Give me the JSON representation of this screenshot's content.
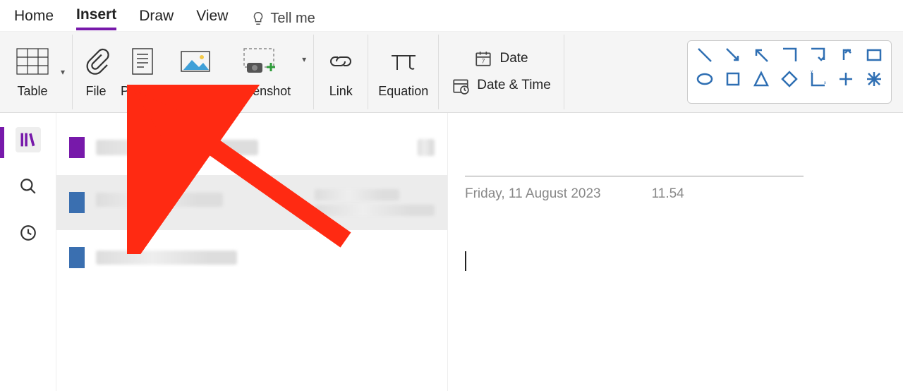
{
  "tabs": {
    "home": "Home",
    "insert": "Insert",
    "draw": "Draw",
    "view": "View",
    "tellme": "Tell me"
  },
  "ribbon": {
    "table": "Table",
    "file": "File",
    "printout": "Printout",
    "picture": "Picture",
    "screenshot": "Screenshot",
    "link": "Link",
    "equation": "Equation",
    "date": "Date",
    "datetime": "Date & Time"
  },
  "page": {
    "date": "Friday, 11 August 2023",
    "time": "11.54"
  },
  "colors": {
    "accent": "#7719AA",
    "shape": "#2f6fb3"
  }
}
